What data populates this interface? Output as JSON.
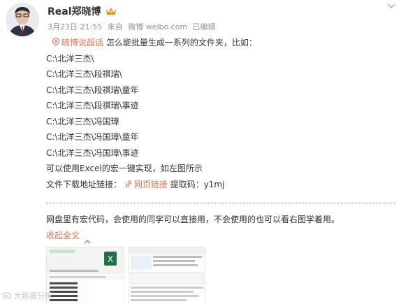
{
  "author": {
    "name": "Real郑晓博",
    "badge_icon": "vip-crown-icon"
  },
  "meta": {
    "date": "3月23日 21:55",
    "source_prefix": "来自",
    "source": "微博 weibo.com",
    "edited": "已编辑"
  },
  "post": {
    "topic": "晓博说超话",
    "question": "怎么能批量生成一系列的文件夹，比如：",
    "paths": [
      "C:\\北洋三杰\\",
      "C:\\北洋三杰\\段祺瑞\\",
      "C:\\北洋三杰\\段祺瑞\\童年",
      "C:\\北洋三杰\\段祺瑞\\事迹",
      "C:\\北洋三杰\\冯国璋",
      "C:\\北洋三杰\\冯国璋\\童年",
      "C:\\北洋三杰\\冯国璋\\事迹"
    ],
    "excel_line": "可以使用Excel的宏一键实现，如左图所示",
    "download_prefix": "文件下载地址链接：",
    "download_link": "网页链接",
    "code_label": "提取码：y1mj",
    "divider": "------------------------------------------------------------------------------------------",
    "note": "网盘里有宏代码，会使用的同学可以直接用，不会使用的也可以看右图学着用。",
    "collapse_label": "收起全文"
  },
  "watermark": "大数据分析"
}
